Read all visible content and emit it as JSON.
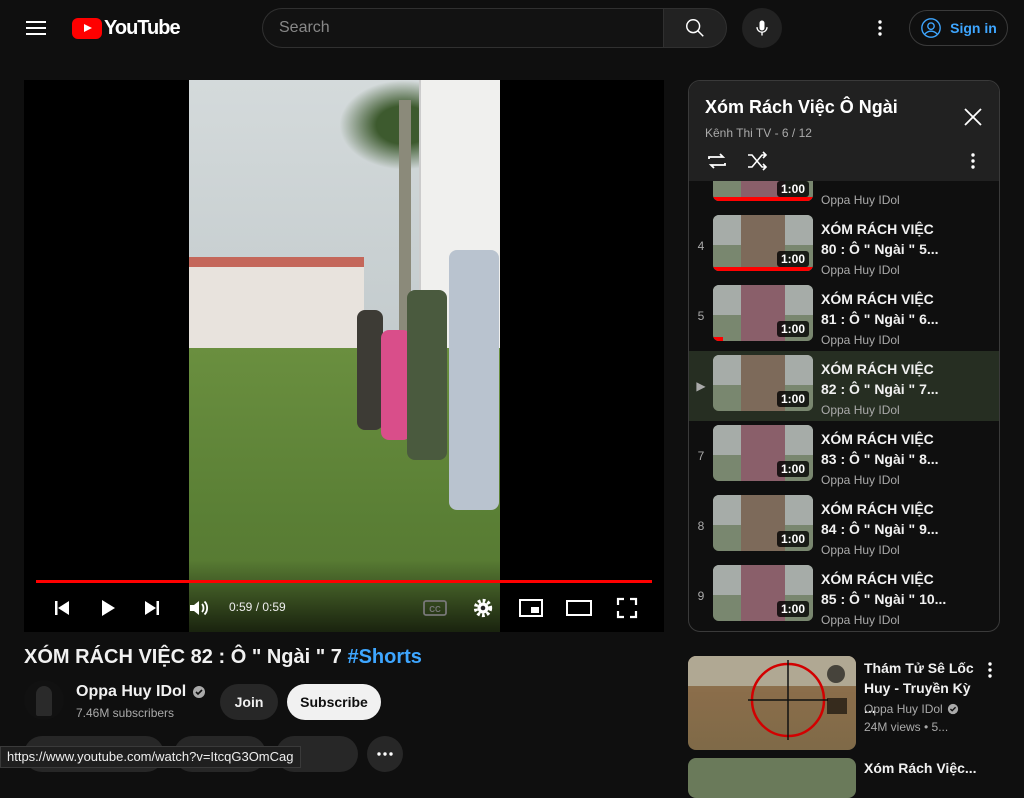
{
  "header": {
    "logo_text": "YouTube",
    "search_placeholder": "Search",
    "sign_in_label": "Sign in"
  },
  "player": {
    "time": "0:59 / 0:59",
    "progress": 1.0
  },
  "video": {
    "title_main": "XÓM RÁCH VIỆC 82 : Ô \" Ngài \" 7 ",
    "title_hashtag": "#Shorts",
    "channel_name": "Oppa Huy IDol",
    "subscribers": "7.46M subscribers",
    "join_label": "Join",
    "subscribe_label": "Subscribe"
  },
  "playlist": {
    "title": "Xóm Rách Việc Ô Ngài",
    "subtitle": "Kênh Thi TV - 6 / 12",
    "items": [
      {
        "index": "",
        "title": "",
        "channel": "Oppa Huy IDol",
        "duration": "1:00",
        "progress": 1.0,
        "active": false
      },
      {
        "index": "4",
        "title": "XÓM RÁCH VIỆC 80 : Ô \" Ngài \" 5...",
        "channel": "Oppa Huy IDol",
        "duration": "1:00",
        "progress": 1.0,
        "active": false
      },
      {
        "index": "5",
        "title": "XÓM RÁCH VIỆC 81 : Ô \" Ngài \" 6...",
        "channel": "Oppa Huy IDol",
        "duration": "1:00",
        "progress": 0.1,
        "active": false
      },
      {
        "index": "▶",
        "title": "XÓM RÁCH VIỆC 82 : Ô \" Ngài \" 7...",
        "channel": "Oppa Huy IDol",
        "duration": "1:00",
        "progress": 0,
        "active": true
      },
      {
        "index": "7",
        "title": "XÓM RÁCH VIỆC 83 : Ô \" Ngài \" 8...",
        "channel": "Oppa Huy IDol",
        "duration": "1:00",
        "progress": 0,
        "active": false
      },
      {
        "index": "8",
        "title": "XÓM RÁCH VIỆC 84 : Ô \" Ngài \" 9...",
        "channel": "Oppa Huy IDol",
        "duration": "1:00",
        "progress": 0,
        "active": false
      },
      {
        "index": "9",
        "title": "XÓM RÁCH VIỆC 85 : Ô \" Ngài \" 10...",
        "channel": "Oppa Huy IDol",
        "duration": "1:00",
        "progress": 0,
        "active": false
      }
    ]
  },
  "recommendations": [
    {
      "title": "Thám Tử Sê Lốc Huy - Truyền Kỳ ...",
      "channel": "Oppa Huy IDol",
      "meta": "24M views • 5..."
    },
    {
      "title": "Xóm Rách Việc..."
    }
  ],
  "status_url": "https://www.youtube.com/watch?v=ItcqG3OmCag",
  "colors": {
    "accent": "#ff0000",
    "link": "#3ea6ff",
    "background": "#0f0f0f"
  }
}
